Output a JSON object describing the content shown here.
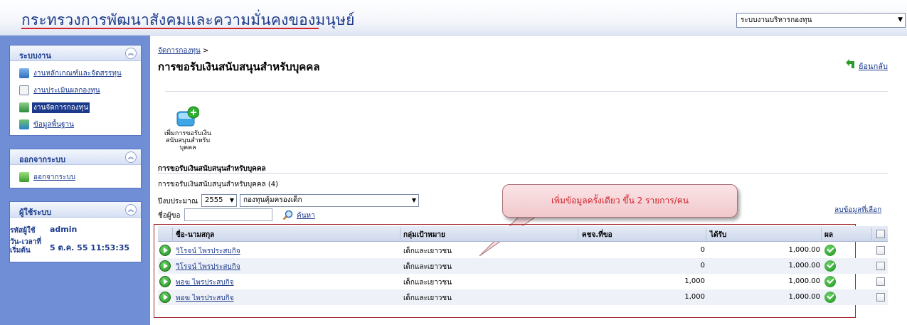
{
  "header": {
    "site_title": "กระทรวงการพัฒนาสังคมและความมั่นคงของมนุษย์",
    "system_select": "ระบบงานบริหารกองทุน"
  },
  "sidebar": {
    "system_panel": {
      "title": "ระบบงาน",
      "items": [
        {
          "label": "งานหลักเกณฑ์และจัดสรรทุน",
          "icon": "document-icon",
          "active": false
        },
        {
          "label": "งานประเมินผลกองทุน",
          "icon": "report-icon",
          "active": false
        },
        {
          "label": "งานจัดการกองทุน",
          "icon": "fund-icon",
          "active": true
        },
        {
          "label": "ข้อมูลพื้นฐาน",
          "icon": "pin-icon",
          "active": false
        }
      ]
    },
    "logout_panel": {
      "title": "ออกจากระบบ",
      "items": [
        {
          "label": "ออกจากระบบ",
          "icon": "logout-icon"
        }
      ]
    },
    "user_panel": {
      "title": "ผู้ใช้ระบบ",
      "user_code_label": "รหัสผู้ใช้",
      "user_code": "admin",
      "login_time_label_1": "วัน-เวลาที่",
      "login_time_label_2": "เริ่มต้น",
      "login_time": "5 ต.ค. 55 11:53:35"
    }
  },
  "main": {
    "breadcrumb": "จัดการกองทุน",
    "breadcrumb_sep": ">",
    "page_title": "การขอรับเงินสนับสนุนสำหรับบุคคล",
    "back_label": "ย้อนกลับ",
    "add_button_label": "เพิ่มการขอรับเงินสนับสนุนสำหรับบุคคล",
    "section_title": "การขอรับเงินสนับสนุนสำหรับบุคคล",
    "count_line": "การขอรับเงินสนับสนุนสำหรับบุคคล (4)",
    "filters": {
      "year_label": "ปีงบประมาณ",
      "year_value": "2555",
      "fund_value": "กองทุนคุ้มครองเด็ก",
      "name_label": "ชื่อผู้ขอ",
      "name_value": "",
      "search_label": "ค้นหา"
    },
    "delete_selected": "ลบข้อมูลที่เลือก",
    "callout": "เพิ่มข้อมูลครั้งเดียว ขึ้น 2 รายการ/คน",
    "table": {
      "headers": [
        "ชื่อ-นามสกุล",
        "กลุ่มเป้าหมาย",
        "คชจ.ที่ขอ",
        "ได้รับ",
        "ผล"
      ],
      "rows": [
        {
          "name": "วิโรจน์ ไพรประสบกิจ",
          "group": "เด็กและเยาวชน",
          "requested": "0",
          "received": "1,000.00"
        },
        {
          "name": "วิโรจน์ ไพรประสบกิจ",
          "group": "เด็กและเยาวชน",
          "requested": "0",
          "received": "1,000.00"
        },
        {
          "name": "พอฆ ไพรประสบกิจ",
          "group": "เด็กและเยาวชน",
          "requested": "1,000",
          "received": "1,000.00"
        },
        {
          "name": "พอฆ ไพรประสบกิจ",
          "group": "เด็กและเยาวชน",
          "requested": "1,000",
          "received": "1,000.00"
        }
      ]
    }
  }
}
